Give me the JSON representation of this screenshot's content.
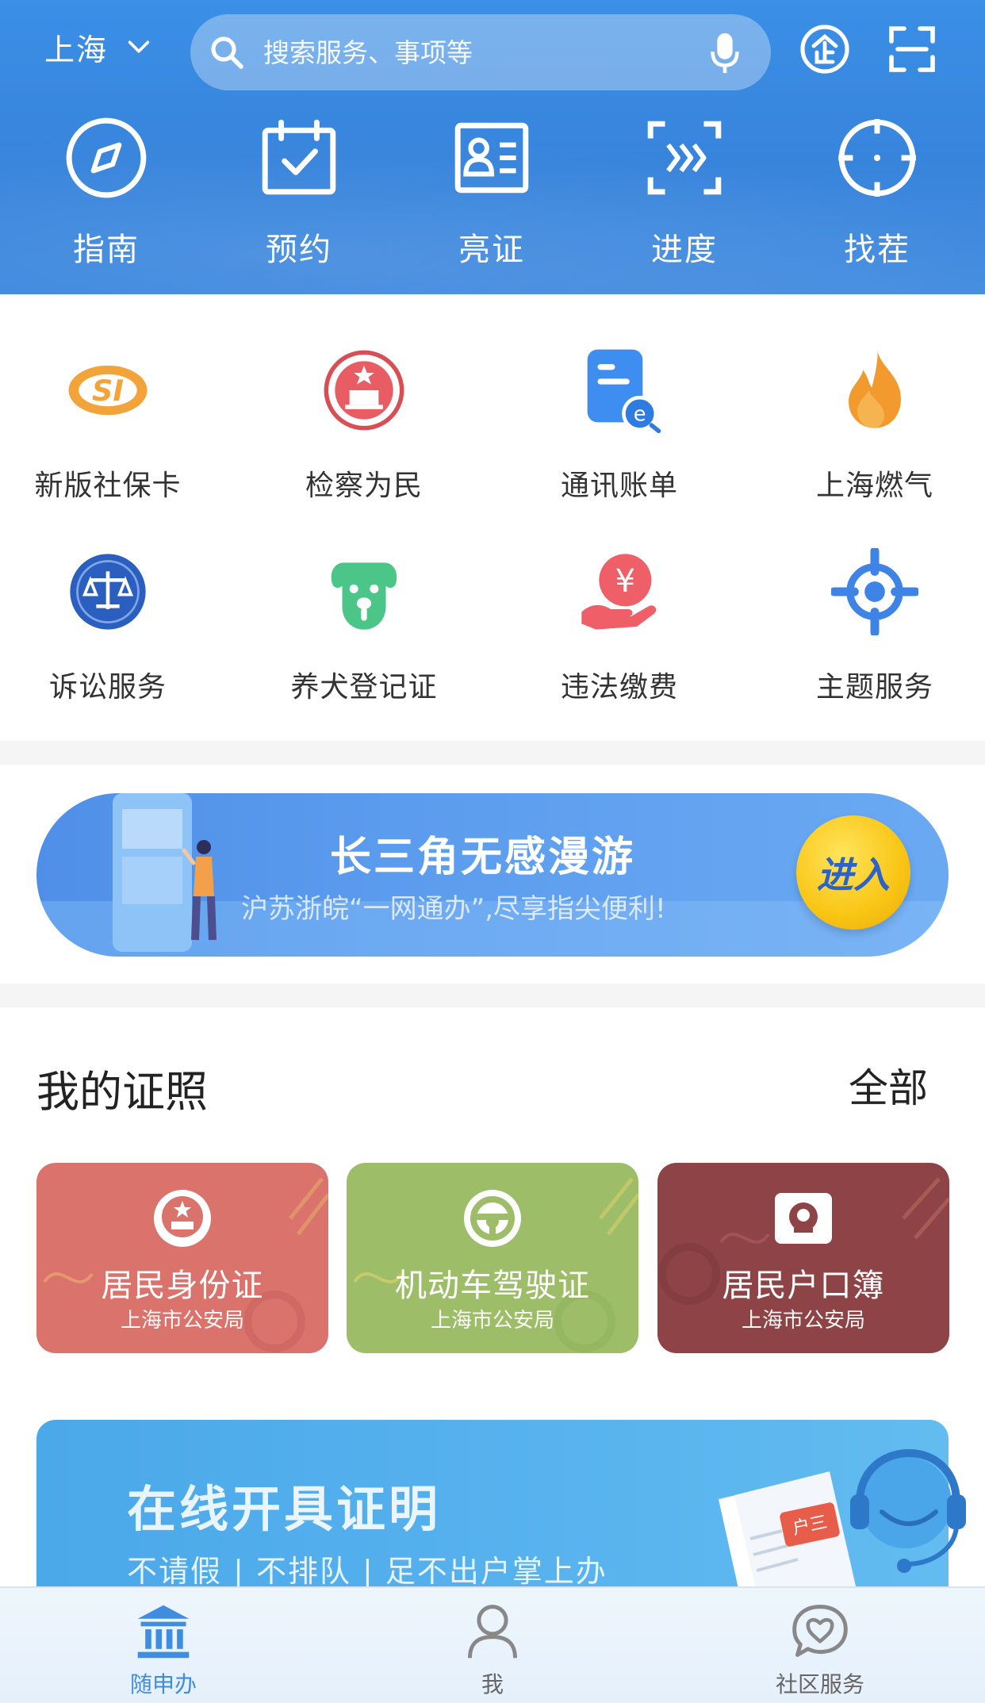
{
  "header": {
    "city": "上海",
    "search_placeholder": "搜索服务、事项等",
    "quick_actions": [
      {
        "label": "指南",
        "icon": "compass-icon"
      },
      {
        "label": "预约",
        "icon": "calendar-check-icon"
      },
      {
        "label": "亮证",
        "icon": "id-card-icon"
      },
      {
        "label": "进度",
        "icon": "progress-icon"
      },
      {
        "label": "找茬",
        "icon": "target-icon"
      }
    ]
  },
  "services": [
    {
      "label": "新版社保卡",
      "icon": "social-security-card-icon"
    },
    {
      "label": "检察为民",
      "icon": "procuratorate-emblem-icon"
    },
    {
      "label": "通讯账单",
      "icon": "e-bill-icon"
    },
    {
      "label": "上海燃气",
      "icon": "flame-icon"
    },
    {
      "label": "诉讼服务",
      "icon": "court-scales-icon"
    },
    {
      "label": "养犬登记证",
      "icon": "dog-icon"
    },
    {
      "label": "违法缴费",
      "icon": "yuan-hand-icon"
    },
    {
      "label": "主题服务",
      "icon": "crosshair-icon"
    }
  ],
  "banner": {
    "title": "长三角无感漫游",
    "subtitle": "沪苏浙皖“一网通办”,尽享指尖便利!",
    "button": "进入"
  },
  "licenses": {
    "title": "我的证照",
    "all_link": "全部",
    "cards": [
      {
        "name": "居民身份证",
        "issuer": "上海市公安局",
        "color": "#d9736c",
        "icon": "national-emblem-icon"
      },
      {
        "name": "机动车驾驶证",
        "issuer": "上海市公安局",
        "color": "#9dbd69",
        "icon": "steering-wheel-icon"
      },
      {
        "name": "居民户口簿",
        "issuer": "上海市公安局",
        "color": "#8e4447",
        "icon": "household-register-icon"
      }
    ]
  },
  "promo": {
    "title": "在线开具证明",
    "subtitle": "不请假 | 不排队 | 足不出户掌上办",
    "badge": "户三"
  },
  "tabbar": [
    {
      "label": "随申办",
      "icon": "government-building-icon",
      "active": true
    },
    {
      "label": "我",
      "icon": "user-icon",
      "active": false
    },
    {
      "label": "社区服务",
      "icon": "heart-chat-icon",
      "active": false
    }
  ],
  "colors": {
    "header_blue": "#3784dc",
    "accent_blue": "#3f8de0",
    "enter_yellow": "#f9c514"
  }
}
